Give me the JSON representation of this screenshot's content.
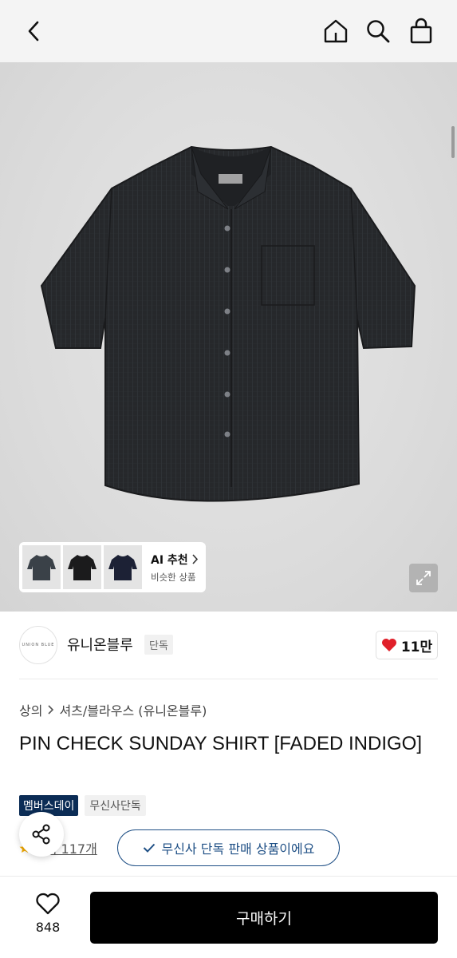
{
  "header": {
    "back_icon": "chevron-left-icon",
    "home_icon": "home-icon",
    "search_icon": "search-icon",
    "bag_icon": "shopping-bag-icon"
  },
  "gallery": {
    "ai_title": "AI 추천",
    "ai_subtitle": "비슷한 상품",
    "thumbnails": [
      "grey-navy shirt",
      "black shirt",
      "navy shirt"
    ],
    "expand_icon": "expand-icon"
  },
  "brand": {
    "logo_text": "UNION BLUE",
    "name": "유니온블루",
    "tag": "단독",
    "likes": "11만",
    "heart_color": "#e0202a"
  },
  "breadcrumb": {
    "level1": "상의",
    "level2": "셔츠/블라우스 (유니온블루)"
  },
  "product": {
    "title": "PIN CHECK SUNDAY SHIRT [FADED INDIGO]"
  },
  "tags": {
    "members": "멤버스데이",
    "exclusive": "무신사단독"
  },
  "review": {
    "text": "후기 117개"
  },
  "toast": {
    "text": "무신사 단독 판매 상품이에요"
  },
  "bottom": {
    "wish_count": "848",
    "buy_label": "구매하기"
  },
  "colors": {
    "accent_navy": "#0b2c55",
    "toast_blue": "#1e4f85"
  }
}
